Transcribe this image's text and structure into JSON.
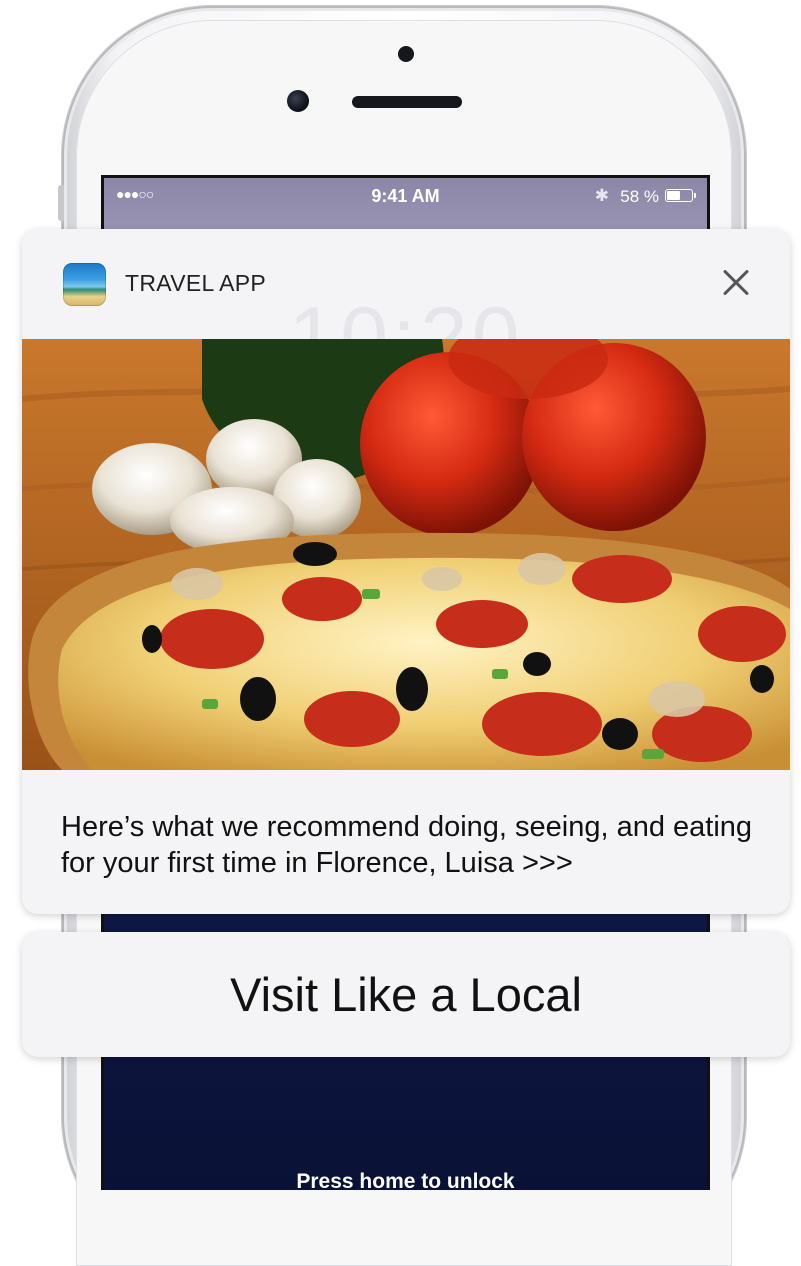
{
  "status_bar": {
    "signal": "●●●○○",
    "time": "9:41 AM",
    "bluetooth_icon": "bluetooth-icon",
    "battery": "58 %",
    "battery_level_fraction": 0.58
  },
  "notification": {
    "app_name": "TRAVEL APP",
    "app_icon": "beach-icon",
    "close_icon": "close-icon",
    "background_clock": "10:20",
    "image": "pizza-photo",
    "message": "Here’s what we recommend doing, seeing, and eating for your first time in Florence, Luisa >>>"
  },
  "action": {
    "label": "Visit Like a Local"
  },
  "lock_screen": {
    "hint": "Press home to unlock"
  },
  "colors": {
    "card_bg": "#f4f4f6",
    "wallpaper_dark": "#0f1846",
    "text": "#111111"
  }
}
